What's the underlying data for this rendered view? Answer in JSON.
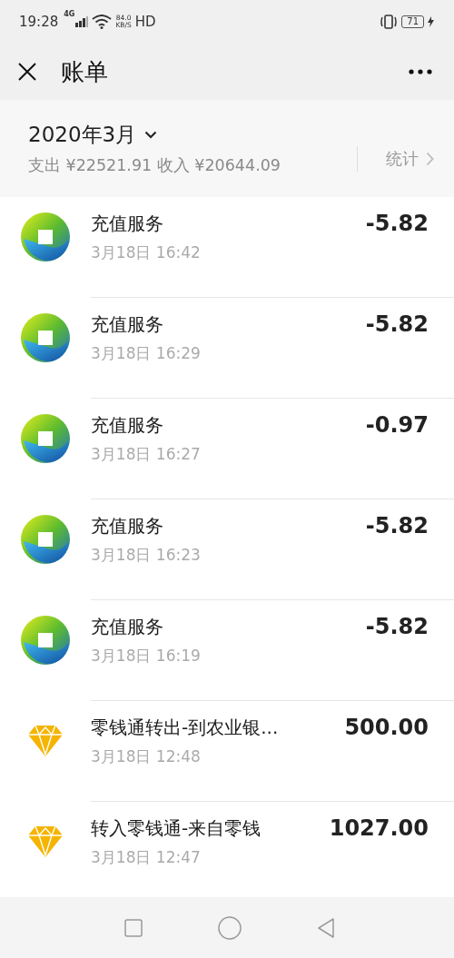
{
  "status_bar": {
    "time": "19:28",
    "network": "4G",
    "speed": "84.0",
    "speed_unit": "KB/S",
    "hd": "HD",
    "battery": "71"
  },
  "title_bar": {
    "title": "账单"
  },
  "summary": {
    "month": "2020年3月",
    "totals": "支出 ¥22521.91 收入 ¥20644.09",
    "stats_link": "统计"
  },
  "transactions": [
    {
      "kind": "recharge",
      "title": "充值服务",
      "time": "3月18日 16:42",
      "amount": "-5.82"
    },
    {
      "kind": "recharge",
      "title": "充值服务",
      "time": "3月18日 16:29",
      "amount": "-5.82"
    },
    {
      "kind": "recharge",
      "title": "充值服务",
      "time": "3月18日 16:27",
      "amount": "-0.97"
    },
    {
      "kind": "recharge",
      "title": "充值服务",
      "time": "3月18日 16:23",
      "amount": "-5.82"
    },
    {
      "kind": "recharge",
      "title": "充值服务",
      "time": "3月18日 16:19",
      "amount": "-5.82"
    },
    {
      "kind": "diamond",
      "title": "零钱通转出-到农业银...",
      "time": "3月18日 12:48",
      "amount": "500.00"
    },
    {
      "kind": "diamond",
      "title": "转入零钱通-来自零钱",
      "time": "3月18日 12:47",
      "amount": "1027.00"
    }
  ]
}
